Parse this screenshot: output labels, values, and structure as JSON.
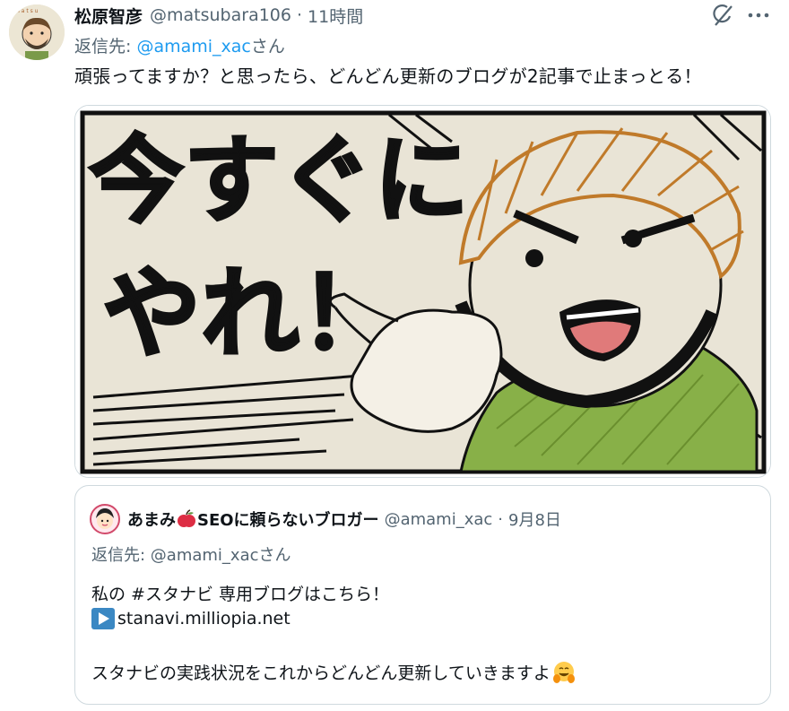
{
  "tweet": {
    "author_name": "松原智彦",
    "author_handle": "@matsubara106",
    "separator": "·",
    "time": "11時間",
    "reply_prefix": "返信先: ",
    "reply_handle": "@amami_xac",
    "reply_suffix": "さん",
    "text": "頑張ってますか？と思ったら、どんどん更新のブログが2記事で止まっとる！",
    "image_text": "今すぐにやれ！"
  },
  "quoted": {
    "author_name_part1": "あまみ",
    "author_name_part2": "SEOに頼らないブロガー",
    "author_handle": "@amami_xac",
    "separator": "·",
    "date": "9月8日",
    "reply_prefix": "返信先: ",
    "reply_handle": "@amami_xac",
    "reply_suffix": "さん",
    "line1_pre": "私の ",
    "line1_hashtag": "#スタナビ",
    "line1_post": " 専用ブログはこちら！",
    "link": "stanavi.milliopia.net",
    "line3": "スタナビの実践状況をこれからどんどん更新していきますよ"
  },
  "icons": {
    "grok": "grok-icon",
    "more": "more-icon",
    "play": "play-button-emoji",
    "apple": "red-apple-emoji",
    "hug": "hugging-face-emoji"
  },
  "colors": {
    "text": "#0f1419",
    "muted": "#536471",
    "link": "#1d9bf0",
    "border": "#cfd9de",
    "shirt": "#88b048",
    "hair": "#c07a2a"
  }
}
